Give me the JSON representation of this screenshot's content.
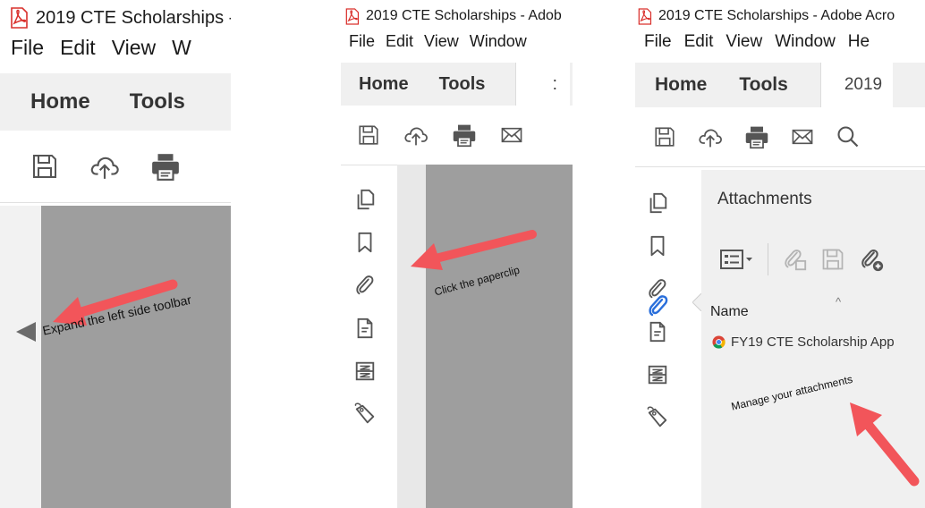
{
  "panel1": {
    "title": "2019 CTE Scholarships -",
    "menu": [
      "File",
      "Edit",
      "View",
      "W"
    ],
    "tabs": [
      "Home",
      "Tools"
    ],
    "callout": "Expand the left side toolbar"
  },
  "panel2": {
    "title": "2019 CTE Scholarships - Adob",
    "menu": [
      "File",
      "Edit",
      "View",
      "Window"
    ],
    "tabs": [
      "Home",
      "Tools"
    ],
    "doc_tab": ":",
    "callout": "Click the paperclip"
  },
  "panel3": {
    "title": "2019 CTE Scholarships - Adobe Acro",
    "menu": [
      "File",
      "Edit",
      "View",
      "Window",
      "He"
    ],
    "tabs": [
      "Home",
      "Tools"
    ],
    "doc_tab": "2019",
    "attachments": {
      "title": "Attachments",
      "column_name": "Name",
      "sort_indicator": "^",
      "file_name": "FY19 CTE Scholarship App"
    },
    "callout": "Manage your attachments"
  },
  "colors": {
    "arrow": "#f2555a",
    "pdf_red": "#d9302c",
    "accent_blue": "#2a6fdb",
    "grey_canvas": "#9e9e9e",
    "icon_grey": "#555555"
  }
}
